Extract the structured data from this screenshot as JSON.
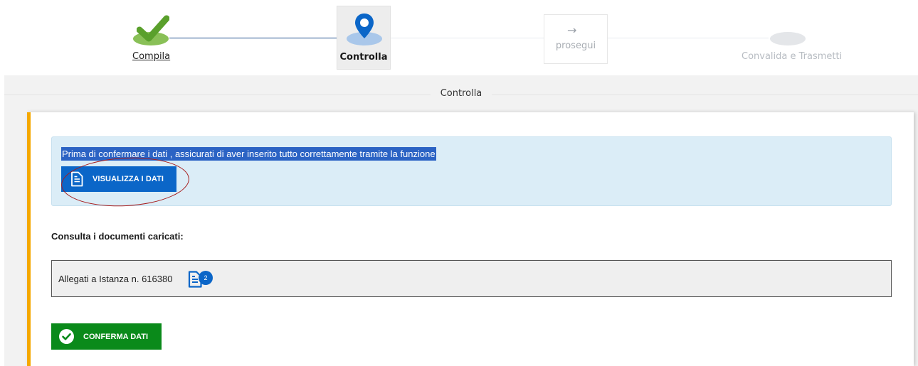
{
  "stepper": {
    "steps": [
      {
        "label": "Compila",
        "state": "completed",
        "icon": "check-icon"
      },
      {
        "label": "Controlla",
        "state": "active",
        "icon": "map-pin-icon"
      },
      {
        "label": "prosegui",
        "state": "next",
        "icon": "arrow-right-icon",
        "arrow": "→"
      },
      {
        "label": "Convalida e Trasmetti",
        "state": "pending",
        "icon": "circle-icon"
      }
    ]
  },
  "section": {
    "title": "Controlla"
  },
  "alert": {
    "text": "Prima di confermare i dati , assicurati di aver inserito tutto correttamente tramite la funzione",
    "button_label": "VISUALIZZA I DATI",
    "button_icon": "document-icon"
  },
  "documents": {
    "heading": "Consulta i documenti caricati:",
    "attachment_label": "Allegati a Istanza n. 616380",
    "attachment_count": "2",
    "attachment_icon": "document-icon"
  },
  "confirm": {
    "button_label": "CONFERMA DATI",
    "button_icon": "check-circle-icon"
  },
  "colors": {
    "accent_blue": "#0b66c8",
    "confirm_green": "#0a8a1a",
    "card_border": "#f5a800",
    "alert_bg": "#dbedf7",
    "check_green": "#89c057"
  }
}
